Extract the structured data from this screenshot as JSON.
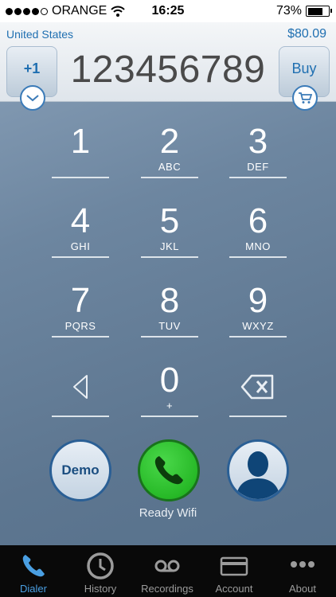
{
  "status_bar": {
    "carrier": "ORANGE",
    "time": "16:25",
    "battery": "73%",
    "battery_level": 0.73,
    "signal_strength": 4
  },
  "header": {
    "country": "United States",
    "balance": "$80.09",
    "country_code": "+1",
    "number": "123456789",
    "buy_label": "Buy"
  },
  "keypad": {
    "keys": [
      {
        "digit": "1",
        "letters": ""
      },
      {
        "digit": "2",
        "letters": "ABC"
      },
      {
        "digit": "3",
        "letters": "DEF"
      },
      {
        "digit": "4",
        "letters": "GHI"
      },
      {
        "digit": "5",
        "letters": "JKL"
      },
      {
        "digit": "6",
        "letters": "MNO"
      },
      {
        "digit": "7",
        "letters": "PQRS"
      },
      {
        "digit": "8",
        "letters": "TUV"
      },
      {
        "digit": "9",
        "letters": "WXYZ"
      },
      {
        "digit": "0",
        "letters": "+"
      }
    ]
  },
  "actions": {
    "demo_label": "Demo",
    "status": "Ready Wifi"
  },
  "tabs": [
    {
      "label": "Dialer",
      "icon": "phone-icon",
      "active": true
    },
    {
      "label": "History",
      "icon": "clock-icon",
      "active": false
    },
    {
      "label": "Recordings",
      "icon": "voicemail-icon",
      "active": false
    },
    {
      "label": "Account",
      "icon": "card-icon",
      "active": false
    },
    {
      "label": "About",
      "icon": "more-icon",
      "active": false
    }
  ],
  "colors": {
    "accent": "#1f6fb1",
    "active_tab": "#4a9fe2",
    "call_green": "#27b927"
  }
}
